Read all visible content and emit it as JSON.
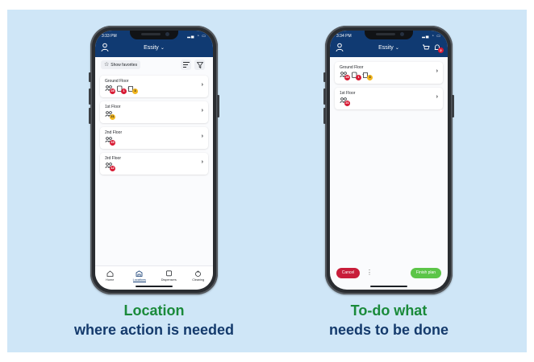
{
  "colors": {
    "background_panel": "#cfe6f7",
    "app_header": "#103a72",
    "badge_red": "#d81b34",
    "badge_yellow": "#f2b61f",
    "cancel": "#c81d3a",
    "finish": "#5cc548",
    "caption_green": "#1a8a3a",
    "caption_blue": "#143a6c"
  },
  "left_phone": {
    "status_time": "3:33 PM",
    "brand": "Essity",
    "filter": {
      "show_favorites_label": "Show favorites",
      "list_icon": "list-icon",
      "filter_icon": "filter-icon"
    },
    "floors": [
      {
        "name": "Ground Floor",
        "items": [
          {
            "icon": "people-icon",
            "count": "28",
            "color": "red"
          },
          {
            "icon": "dispenser-icon",
            "count": "1",
            "color": "red"
          },
          {
            "icon": "cleaning-icon",
            "count": "3",
            "color": "yellow"
          }
        ]
      },
      {
        "name": "1st Floor",
        "items": [
          {
            "icon": "people-icon",
            "count": "21",
            "color": "yellow"
          }
        ]
      },
      {
        "name": "2nd Floor",
        "items": [
          {
            "icon": "people-icon",
            "count": "15",
            "color": "red"
          }
        ]
      },
      {
        "name": "3rd Floor",
        "items": [
          {
            "icon": "people-icon",
            "count": "12",
            "color": "red"
          }
        ]
      }
    ],
    "nav": [
      {
        "label": "Home",
        "icon": "home-icon"
      },
      {
        "label": "Locations",
        "icon": "building-icon",
        "active": true
      },
      {
        "label": "Dispensers",
        "icon": "dispenser-icon"
      },
      {
        "label": "Cleaning",
        "icon": "cleaning-icon"
      }
    ]
  },
  "right_phone": {
    "status_time": "3:34 PM",
    "brand": "Essity",
    "bell_badge": "2",
    "floors": [
      {
        "name": "Ground Floor",
        "items": [
          {
            "icon": "people-icon",
            "count": "28",
            "color": "red"
          },
          {
            "icon": "dispenser-icon",
            "count": "1",
            "color": "red"
          },
          {
            "icon": "cleaning-icon",
            "count": "3",
            "color": "yellow"
          }
        ]
      },
      {
        "name": "1st Floor",
        "items": [
          {
            "icon": "people-icon",
            "count": "21",
            "color": "red"
          }
        ]
      }
    ],
    "cancel_label": "Cancel",
    "more_label": "⋮",
    "finish_label": "Finish plan"
  },
  "captions": {
    "left_title": "Location",
    "left_subtitle": "where action is needed",
    "right_title": "To-do what",
    "right_subtitle": "needs to be done"
  }
}
